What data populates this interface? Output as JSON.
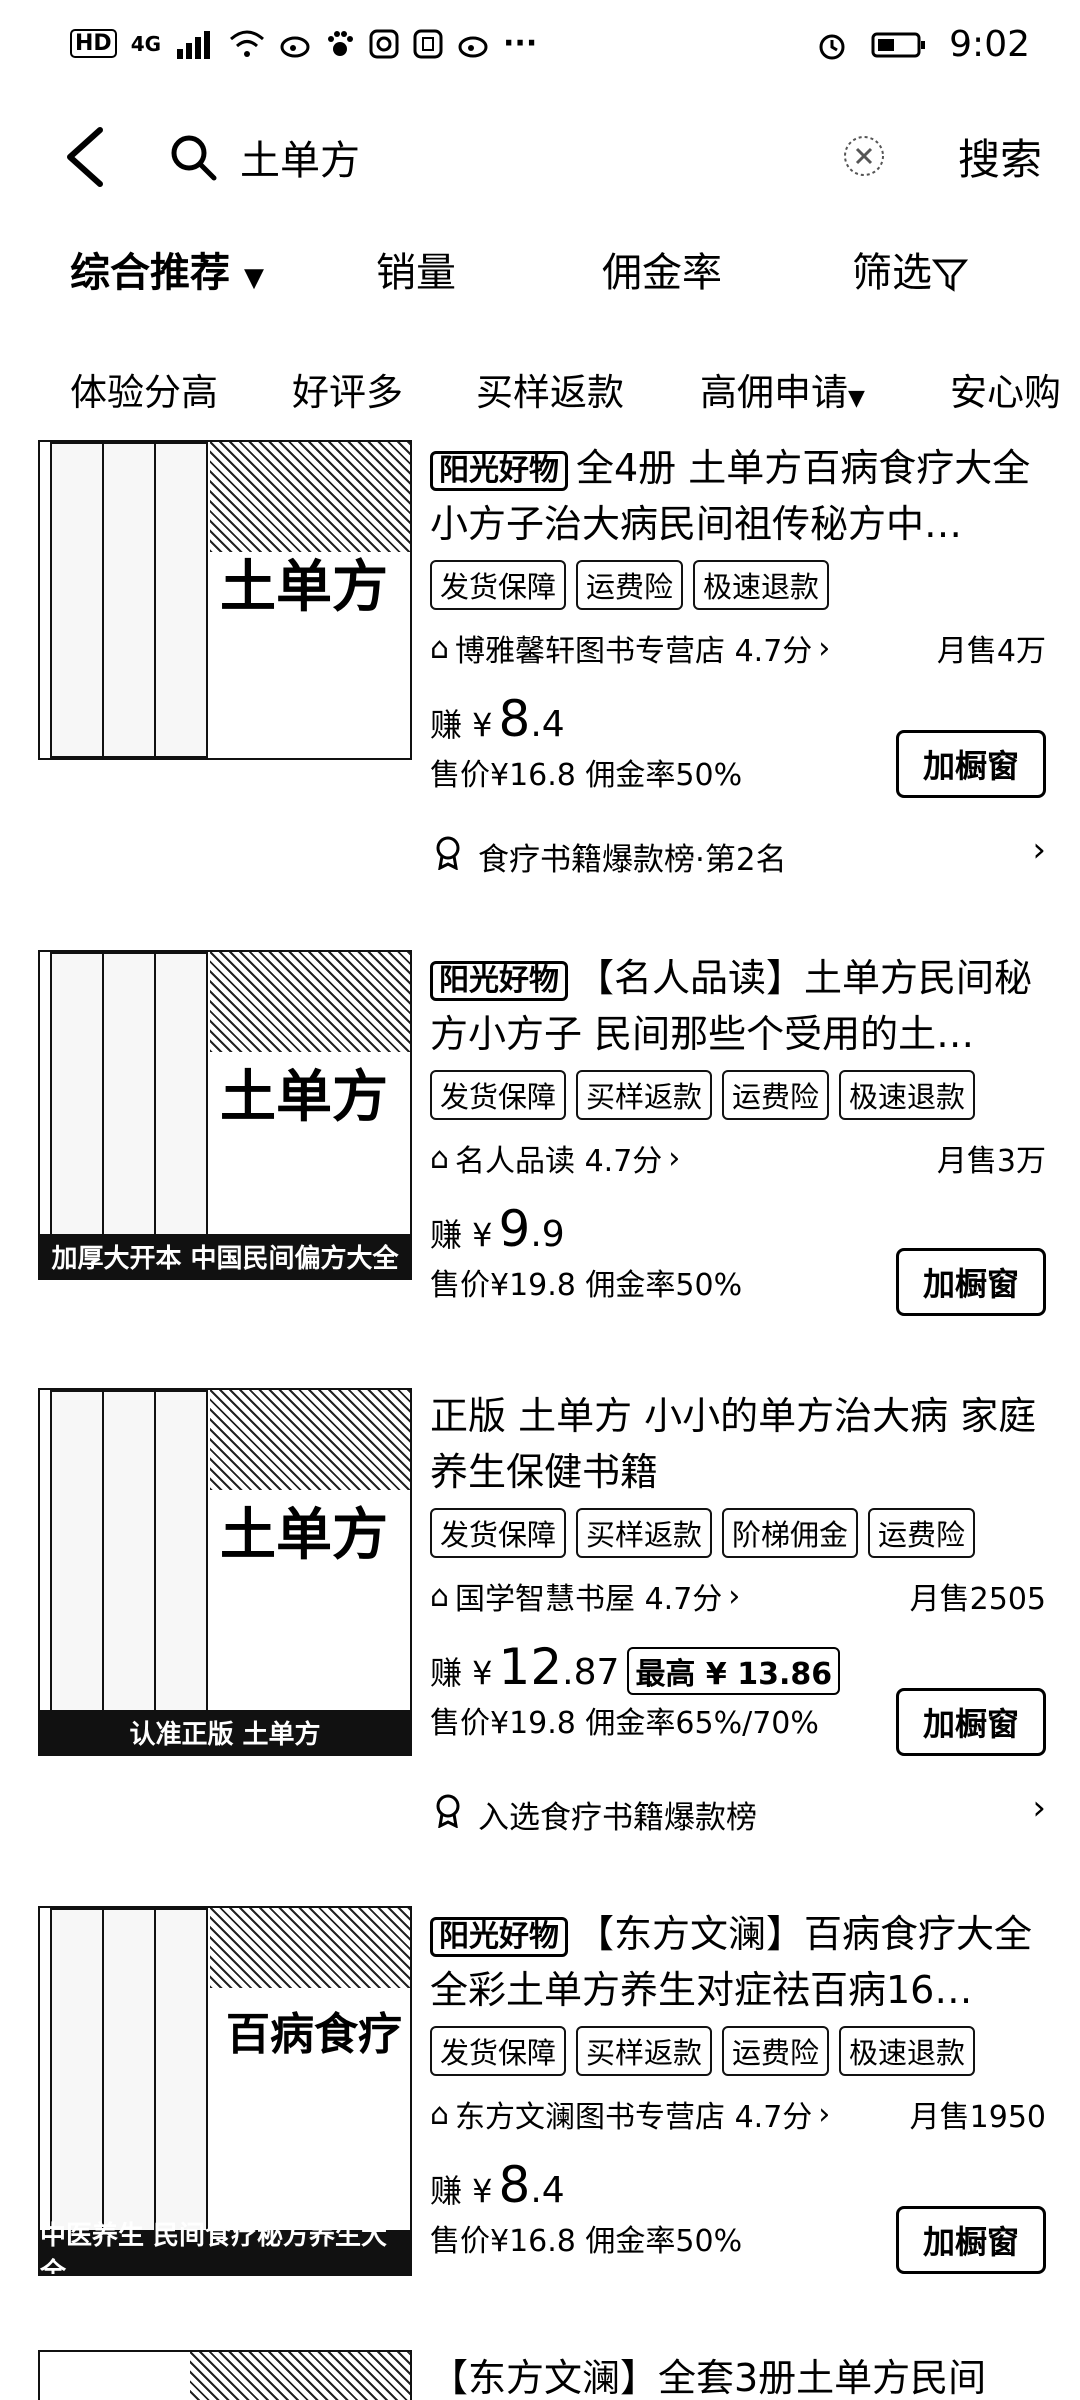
{
  "status_bar": {
    "left_badges": [
      "HD",
      "4G"
    ],
    "time": "9:02",
    "more": "···"
  },
  "search": {
    "query": "土单方",
    "button": "搜索"
  },
  "sort_tabs": [
    "综合推荐",
    "销量",
    "佣金率",
    "筛选"
  ],
  "filters": [
    "体验分高",
    "好评多",
    "买样返款",
    "高佣申请",
    "安心购"
  ],
  "products": [
    {
      "badge": "阳光好物",
      "title": "全4册 土单方百病食疗大全小方子治大病民间祖传秘方中…",
      "tags": [
        "发货保障",
        "运费险",
        "极速退款"
      ],
      "shop": "博雅馨轩图书专营店 4.7分",
      "sales": "月售4万",
      "earn_label": "赚 ¥",
      "earn_int": "8",
      "earn_dec": ".4",
      "max": "",
      "price_line": "售价¥16.8  佣金率50%",
      "button": "加橱窗",
      "rank": "食疗书籍爆款榜·第2名",
      "cover_title": "土单方",
      "cover_banner": ""
    },
    {
      "badge": "阳光好物",
      "title": "【名人品读】土单方民间秘方小方子 民间那些个受用的土…",
      "tags": [
        "发货保障",
        "买样返款",
        "运费险",
        "极速退款"
      ],
      "shop": "名人品读 4.7分",
      "sales": "月售3万",
      "earn_label": "赚 ¥",
      "earn_int": "9",
      "earn_dec": ".9",
      "max": "",
      "price_line": "售价¥19.8  佣金率50%",
      "button": "加橱窗",
      "rank": "",
      "cover_title": "土单方",
      "cover_banner": "加厚大开本  中国民间偏方大全"
    },
    {
      "badge": "",
      "title": "正版 土单方 小小的单方治大病 家庭养生保健书籍",
      "tags": [
        "发货保障",
        "买样返款",
        "阶梯佣金",
        "运费险"
      ],
      "shop": "国学智慧书屋 4.7分",
      "sales": "月售2505",
      "earn_label": "赚 ¥",
      "earn_int": "12",
      "earn_dec": ".87",
      "max": "最高 ¥ 13.86",
      "price_line": "售价¥19.8  佣金率65%/70%",
      "button": "加橱窗",
      "rank": "入选食疗书籍爆款榜",
      "cover_title": "土单方",
      "cover_banner": "认准正版 土单方"
    },
    {
      "badge": "阳光好物",
      "title": "【东方文澜】百病食疗大全全彩土单方养生对症祛百病16…",
      "tags": [
        "发货保障",
        "买样返款",
        "运费险",
        "极速退款"
      ],
      "shop": "东方文澜图书专营店 4.7分",
      "sales": "月售1950",
      "earn_label": "赚 ¥",
      "earn_int": "8",
      "earn_dec": ".4",
      "max": "",
      "price_line": "售价¥16.8  佣金率50%",
      "button": "加橱窗",
      "rank": "",
      "cover_title": "百病食疗",
      "cover_banner": "中医养生 民间食疗秘方养生大全"
    },
    {
      "badge": "",
      "title": "【东方文澜】全套3册土单方民间",
      "tags": [],
      "shop": "",
      "sales": "",
      "earn_label": "",
      "earn_int": "",
      "earn_dec": "",
      "max": "",
      "price_line": "",
      "button": "",
      "rank": "",
      "cover_title": "",
      "cover_banner": ""
    }
  ]
}
